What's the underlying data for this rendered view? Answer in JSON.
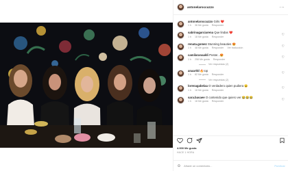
{
  "post": {
    "author": "antonelaroccuzzo",
    "more_icon": "ellipsis-icon",
    "caption_user": "antonelaroccuzzo",
    "caption_text": "Girls ❤️",
    "caption_time": "1 h",
    "caption_likes": "36 Me gusta",
    "caption_reply": "Responder"
  },
  "comments": [
    {
      "user": "sabrinagarciarena",
      "text": "Que lindas ❤️",
      "time": "1 h",
      "likes": "18 Me gusta",
      "reply": "Responder",
      "see_translation": ""
    },
    {
      "user": "renata.gomez",
      "text": "Stunning beauties 😍",
      "time": "1 h",
      "likes": "48 Me gusta",
      "reply": "Responder",
      "see_translation": "Ver traducción"
    },
    {
      "user": "camilaranaaldi",
      "text": "Posta!...😍",
      "time": "1 h",
      "likes": "258 Me gusta",
      "reply": "Responder",
      "see_translation": ""
    },
    {
      "user": "anaartld",
      "text": "🔥top",
      "time": "1 h",
      "likes": "82 Me gusta",
      "reply": "Responder",
      "see_translation": ""
    },
    {
      "user": "lorenagabelaa",
      "text": "O verdadero quien pudiera 😮",
      "time": "1 h",
      "likes": "18 Me gusta",
      "reply": "Responder",
      "see_translation": ""
    },
    {
      "user": "sara.basaee",
      "text": "O contenido que quiero ver 😂😂😂",
      "time": "1 h",
      "likes": "18 Me gusta",
      "reply": "Responder",
      "see_translation": ""
    }
  ],
  "replies_label_1": "Ver respuestas (2)",
  "replies_label_2": "Ver respuestas (2)",
  "replies_label_3": "Ver respuestas (1)",
  "likes_count": "4.000 Me gusta",
  "date": "HACE 1 HORA",
  "add_comment_placeholder": "Añade un comentario...",
  "publish_label": "Publicar",
  "colors": {
    "heart": "#ed4956",
    "muted": "#8e8e8e",
    "publish_disabled": "#b2dffc"
  }
}
